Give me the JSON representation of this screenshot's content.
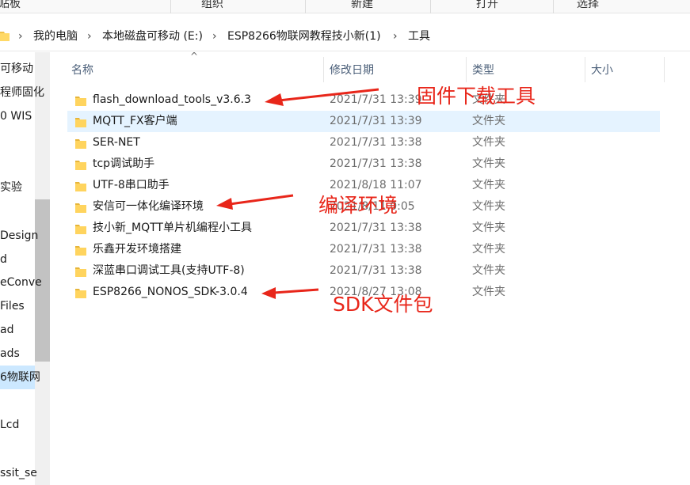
{
  "ribbon": {
    "groups": [
      "贴板",
      "组织",
      "新建",
      "打开",
      "选择"
    ]
  },
  "address_bar": {
    "icon": "folder-icon",
    "crumbs": [
      "我的电脑",
      "本地磁盘可移动 (E:)",
      "ESP8266物联网教程技小新(1)",
      "工具"
    ]
  },
  "nav": {
    "items": [
      "可移动",
      "程师固化",
      "0 WIS",
      "实验",
      "Design",
      "d",
      "eConve",
      "Files",
      "ad",
      "ads",
      "6物联网",
      "Lcd",
      "ssit_se"
    ]
  },
  "columns": {
    "name": "名称",
    "date": "修改日期",
    "type": "类型",
    "size": "大小"
  },
  "files": [
    {
      "name": "flash_download_tools_v3.6.3",
      "date": "2021/7/31 13:39",
      "type": "文件夹",
      "icon": "folder-icon"
    },
    {
      "name": "MQTT_FX客户端",
      "date": "2021/7/31 13:39",
      "type": "文件夹",
      "icon": "folder-icon"
    },
    {
      "name": "SER-NET",
      "date": "2021/7/31 13:38",
      "type": "文件夹",
      "icon": "folder-icon"
    },
    {
      "name": "tcp调试助手",
      "date": "2021/7/31 13:38",
      "type": "文件夹",
      "icon": "folder-icon"
    },
    {
      "name": "UTF-8串口助手",
      "date": "2021/8/18 11:07",
      "type": "文件夹",
      "icon": "folder-icon"
    },
    {
      "name": "安信可一体化编译环境",
      "date": "2021/8/11 0:05",
      "type": "文件夹",
      "icon": "folder-icon"
    },
    {
      "name": "技小新_MQTT单片机编程小工具",
      "date": "2021/7/31 13:38",
      "type": "文件夹",
      "icon": "folder-icon"
    },
    {
      "name": "乐鑫开发环境搭建",
      "date": "2021/7/31 13:38",
      "type": "文件夹",
      "icon": "folder-icon"
    },
    {
      "name": "深蓝串口调试工具(支持UTF-8)",
      "date": "2021/7/31 13:38",
      "type": "文件夹",
      "icon": "folder-icon"
    },
    {
      "name": "ESP8266_NONOS_SDK-3.0.4",
      "date": "2021/8/27 13:08",
      "type": "文件夹",
      "icon": "folder-icon"
    }
  ],
  "annotations": {
    "firmware": "固件下载工具",
    "compile": "编译环境",
    "sdk": "SDK文件包"
  },
  "colors": {
    "annotation": "#e8261a",
    "folder": "#f0c24b",
    "selected_row": "#e5f3ff",
    "header_text": "#4c607a"
  }
}
